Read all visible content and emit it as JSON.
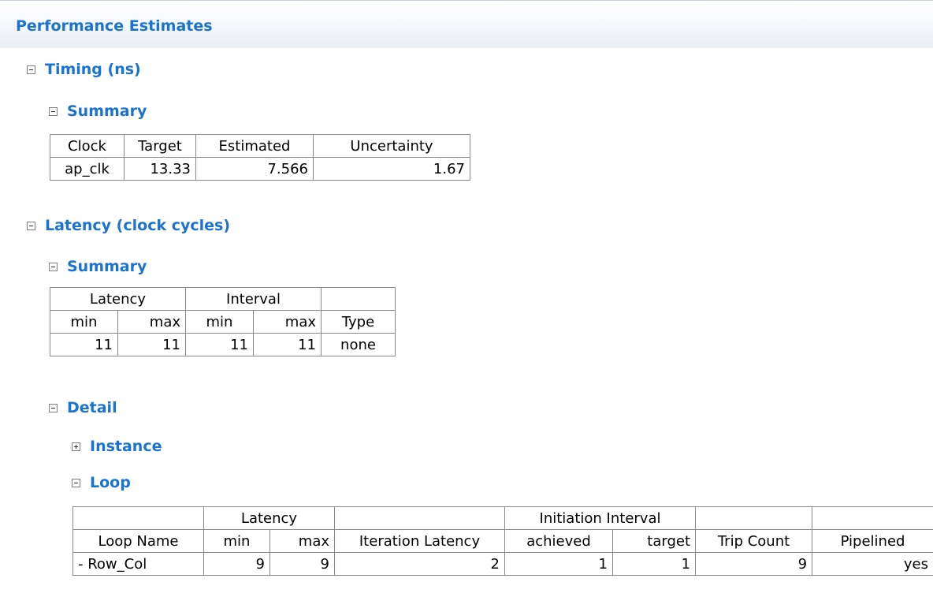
{
  "page_title": "Performance Estimates",
  "sections": {
    "timing": "Timing (ns)",
    "timing_summary": "Summary",
    "latency": "Latency (clock cycles)",
    "latency_summary": "Summary",
    "detail": "Detail",
    "instance": "Instance",
    "loop": "Loop"
  },
  "timing_table": {
    "headers": [
      "Clock",
      "Target",
      "Estimated",
      "Uncertainty"
    ],
    "row": [
      "ap_clk",
      "13.33",
      "7.566",
      "1.67"
    ]
  },
  "latency_table": {
    "group_headers": [
      "Latency",
      "Interval",
      ""
    ],
    "headers": [
      "min",
      "max",
      "min",
      "max",
      "Type"
    ],
    "row": [
      "11",
      "11",
      "11",
      "11",
      "none"
    ]
  },
  "loop_table": {
    "group_headers": [
      "",
      "Latency",
      "",
      "Initiation Interval",
      "",
      ""
    ],
    "headers": [
      "Loop Name",
      "min",
      "max",
      "Iteration Latency",
      "achieved",
      "target",
      "Trip Count",
      "Pipelined"
    ],
    "row": [
      "- Row_Col",
      "9",
      "9",
      "2",
      "1",
      "1",
      "9",
      "yes"
    ]
  }
}
